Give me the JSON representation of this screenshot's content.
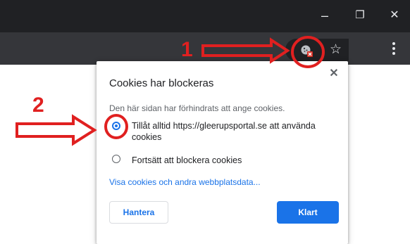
{
  "window": {
    "minimize_glyph": "–",
    "restore_glyph": "❐",
    "close_glyph": "✕"
  },
  "toolbar": {
    "cookie_icon": "cookie-blocked-icon",
    "star_glyph": "☆"
  },
  "popup": {
    "title": "Cookies har blockeras",
    "description": "Den här sidan har förhindrats att ange cookies.",
    "close_glyph": "✕",
    "options": [
      {
        "label": "Tillåt alltid https://gleerupsportal.se att använda cookies",
        "selected": true
      },
      {
        "label": "Fortsätt att blockera cookies",
        "selected": false
      }
    ],
    "link": "Visa cookies och andra webbplatsdata...",
    "secondary_button": "Hantera",
    "primary_button": "Klart"
  },
  "annotations": {
    "step1": "1",
    "step2": "2",
    "color": "#e02020"
  },
  "colors": {
    "accent": "#1a73e8",
    "titlebar": "#202124",
    "toolbar": "#35363a"
  }
}
